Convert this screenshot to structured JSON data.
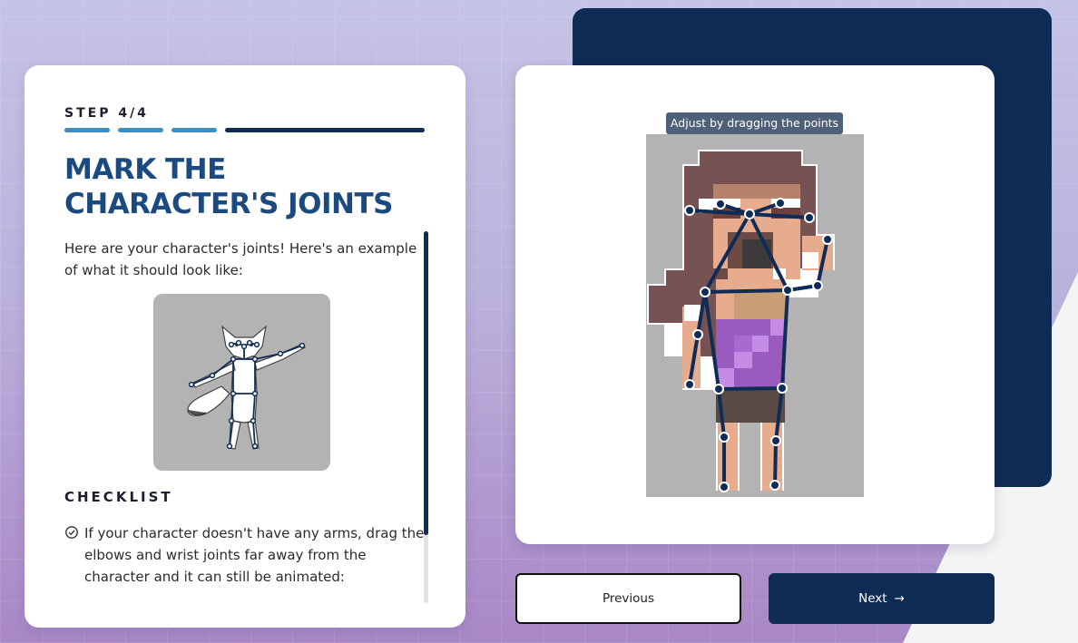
{
  "step": {
    "label": "STEP 4/4",
    "current": 4,
    "total": 4
  },
  "title": "MARK THE CHARACTER'S JOINTS",
  "intro": "Here are your character's joints! Here's an example of what it should look like:",
  "checklist": {
    "heading": "CHECKLIST",
    "items": [
      "If your character doesn't have any arms, drag the elbows and wrist joints far away from the character and it can still be animated:"
    ]
  },
  "canvas": {
    "tooltip": "Adjust by dragging the points"
  },
  "buttons": {
    "previous": "Previous",
    "next": "Next",
    "next_icon": "→"
  },
  "colors": {
    "navy": "#0e2c55",
    "title_blue": "#1a4a7f",
    "progress_done": "#3d8ec2",
    "canvas_gray": "#b3b3b3"
  },
  "icons": {
    "check": "check-circle-icon",
    "next": "arrow-right-icon"
  }
}
